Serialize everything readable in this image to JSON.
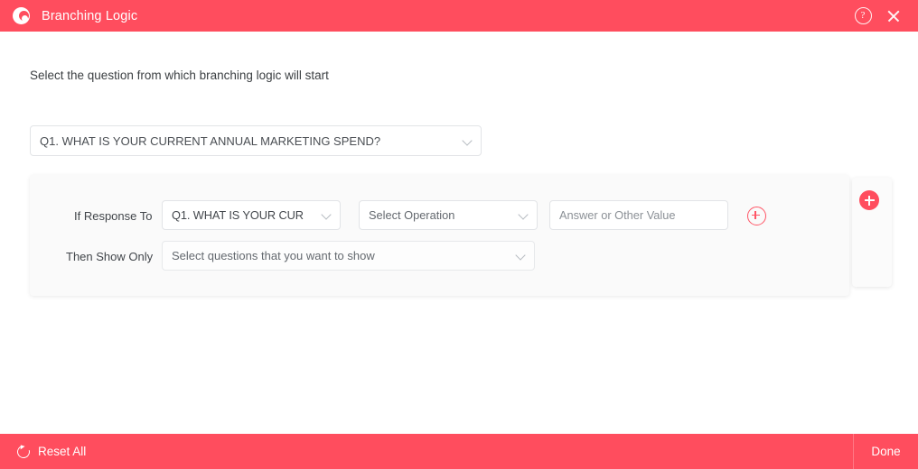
{
  "window": {
    "title": "Branching Logic",
    "brand_icon": "c-logo-icon",
    "help_icon": "?",
    "close_icon": "close-icon",
    "accent_color": "#ff4d5e"
  },
  "main": {
    "prompt": "Select the question from which branching logic will start",
    "root_question": {
      "value": "Q1. WHAT IS YOUR CURRENT ANNUAL MARKETING SPEND?"
    },
    "rule_card": {
      "if_label": "If Response To",
      "question_select": {
        "value": "Q1. WHAT IS YOUR CUR"
      },
      "operation_select": {
        "value": "Select Operation"
      },
      "answer_input": {
        "value": "",
        "placeholder": "Answer or Other Value"
      },
      "add_condition_icon": "circle-plus-outline-icon",
      "then_label": "Then Show Only",
      "show_select": {
        "value": "Select questions that you want to show"
      }
    },
    "add_rule_card": {
      "add_icon": "circle-plus-solid-icon"
    }
  },
  "footer": {
    "reset_label": "Reset All",
    "reset_icon": "reset-icon",
    "done_label": "Done"
  }
}
